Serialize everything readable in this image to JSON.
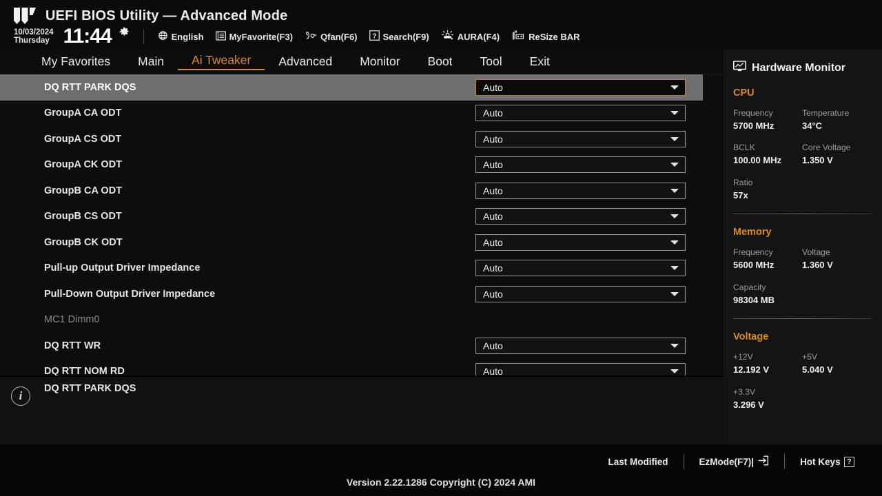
{
  "header": {
    "logo_icon": "tuf-shield-logo",
    "title": "UEFI BIOS Utility — Advanced Mode",
    "date": "10/03/2024",
    "weekday": "Thursday",
    "time": "11:44",
    "gear_icon": "gear-icon",
    "actions": [
      {
        "icon": "globe-icon",
        "label": "English"
      },
      {
        "icon": "list-icon",
        "label": "MyFavorite(F3)"
      },
      {
        "icon": "fan-icon",
        "label": "Qfan(F6)"
      },
      {
        "icon": "question-box-icon",
        "label": "Search(F9)"
      },
      {
        "icon": "aura-light-icon",
        "label": "AURA(F4)"
      },
      {
        "icon": "resize-bar-icon",
        "label": "ReSize BAR"
      }
    ]
  },
  "nav": {
    "items": [
      {
        "label": "My Favorites",
        "active": false
      },
      {
        "label": "Main",
        "active": false
      },
      {
        "label": "Ai Tweaker",
        "active": true
      },
      {
        "label": "Advanced",
        "active": false
      },
      {
        "label": "Monitor",
        "active": false
      },
      {
        "label": "Boot",
        "active": false
      },
      {
        "label": "Tool",
        "active": false
      },
      {
        "label": "Exit",
        "active": false
      }
    ]
  },
  "settings": {
    "rows": [
      {
        "label": "DQ RTT PARK DQS",
        "value": "Auto",
        "type": "dropdown",
        "selected": true
      },
      {
        "label": "GroupA CA ODT",
        "value": "Auto",
        "type": "dropdown",
        "selected": false
      },
      {
        "label": "GroupA CS ODT",
        "value": "Auto",
        "type": "dropdown",
        "selected": false
      },
      {
        "label": "GroupA CK ODT",
        "value": "Auto",
        "type": "dropdown",
        "selected": false
      },
      {
        "label": "GroupB CA ODT",
        "value": "Auto",
        "type": "dropdown",
        "selected": false
      },
      {
        "label": "GroupB CS ODT",
        "value": "Auto",
        "type": "dropdown",
        "selected": false
      },
      {
        "label": "GroupB CK ODT",
        "value": "Auto",
        "type": "dropdown",
        "selected": false
      },
      {
        "label": "Pull-up Output Driver Impedance",
        "value": "Auto",
        "type": "dropdown",
        "selected": false
      },
      {
        "label": "Pull-Down Output Driver Impedance",
        "value": "Auto",
        "type": "dropdown",
        "selected": false
      },
      {
        "label": "MC1 Dimm0",
        "value": "",
        "type": "section",
        "selected": false
      },
      {
        "label": "DQ RTT WR",
        "value": "Auto",
        "type": "dropdown",
        "selected": false
      },
      {
        "label": "DQ RTT NOM RD",
        "value": "Auto",
        "type": "dropdown",
        "selected": false
      }
    ]
  },
  "help": {
    "icon": "info-icon",
    "text": "DQ RTT PARK DQS"
  },
  "hardware_monitor": {
    "icon": "monitor-icon",
    "title": "Hardware Monitor",
    "sections": [
      {
        "name": "CPU",
        "entries": [
          {
            "key": "Frequency",
            "value": "5700 MHz"
          },
          {
            "key": "Temperature",
            "value": "34°C"
          },
          {
            "key": "BCLK",
            "value": "100.00 MHz"
          },
          {
            "key": "Core Voltage",
            "value": "1.350 V"
          },
          {
            "key": "Ratio",
            "value": "57x"
          }
        ]
      },
      {
        "name": "Memory",
        "entries": [
          {
            "key": "Frequency",
            "value": "5600 MHz"
          },
          {
            "key": "Voltage",
            "value": "1.360 V"
          },
          {
            "key": "Capacity",
            "value": "98304 MB"
          }
        ]
      },
      {
        "name": "Voltage",
        "entries": [
          {
            "key": "+12V",
            "value": "12.192 V"
          },
          {
            "key": "+5V",
            "value": "5.040 V"
          },
          {
            "key": "+3.3V",
            "value": "3.296 V"
          }
        ]
      }
    ]
  },
  "footer": {
    "last_modified": "Last Modified",
    "ezmode": "EzMode(F7)|",
    "ezmode_icon": "arrow-into-box-icon",
    "hotkeys": "Hot Keys",
    "hotkeys_key": "?",
    "version": "Version 2.22.1286 Copyright (C) 2024 AMI"
  },
  "colors": {
    "accent": "#d98c23",
    "selected_row": "#6e6e6e",
    "panel": "#141414",
    "background": "#0d0d0d"
  }
}
